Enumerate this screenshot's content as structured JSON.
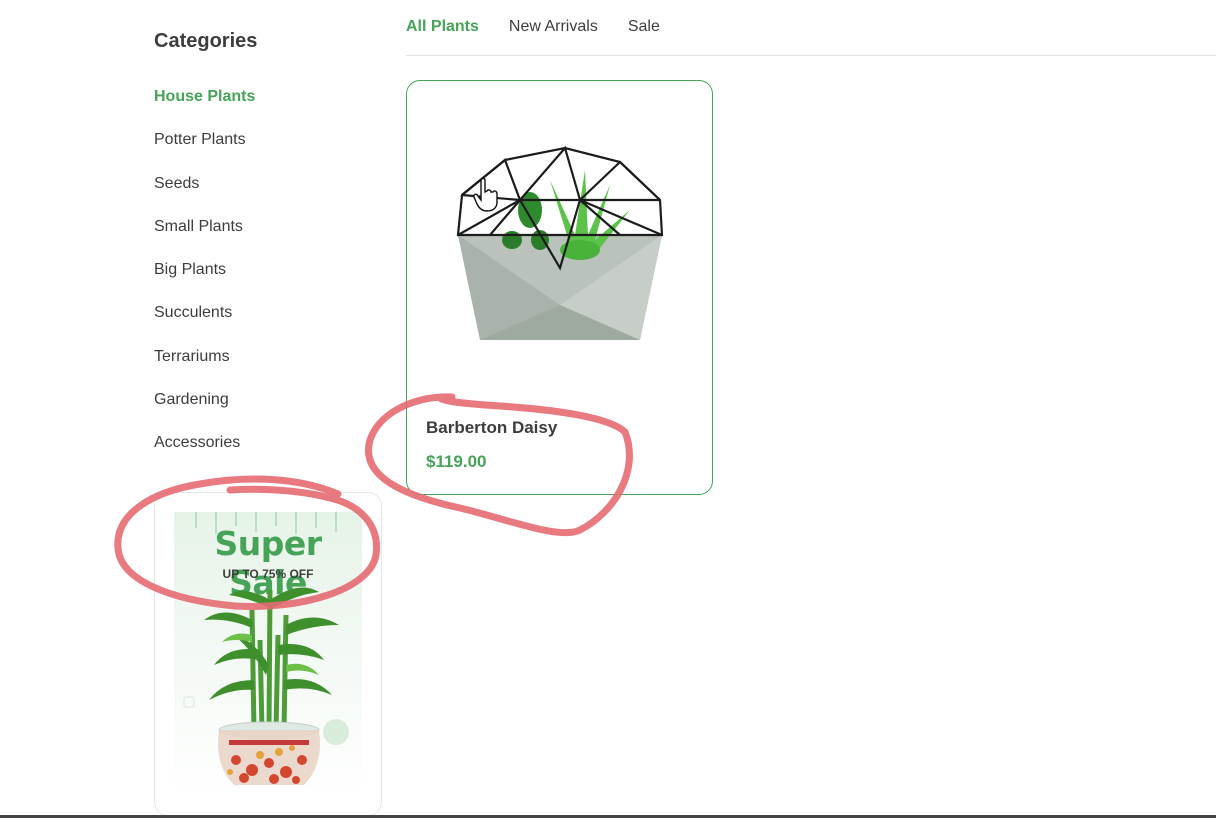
{
  "sidebar": {
    "title": "Categories",
    "items": [
      {
        "label": "House Plants",
        "active": true
      },
      {
        "label": "Potter Plants"
      },
      {
        "label": "Seeds"
      },
      {
        "label": "Small Plants"
      },
      {
        "label": "Big Plants"
      },
      {
        "label": "Succulents"
      },
      {
        "label": "Terrariums"
      },
      {
        "label": "Gardening"
      },
      {
        "label": "Accessories"
      }
    ]
  },
  "tabs": [
    {
      "label": "All Plants",
      "active": true
    },
    {
      "label": "New Arrivals"
    },
    {
      "label": "Sale"
    }
  ],
  "product": {
    "name": "Barberton Daisy",
    "price": "$119.00"
  },
  "sale_banner": {
    "title": "Super Sale",
    "subtitle": "UP TO 75% OFF"
  },
  "colors": {
    "accent": "#46a358",
    "text": "#3d3d3d",
    "annotation": "#e56b72"
  }
}
